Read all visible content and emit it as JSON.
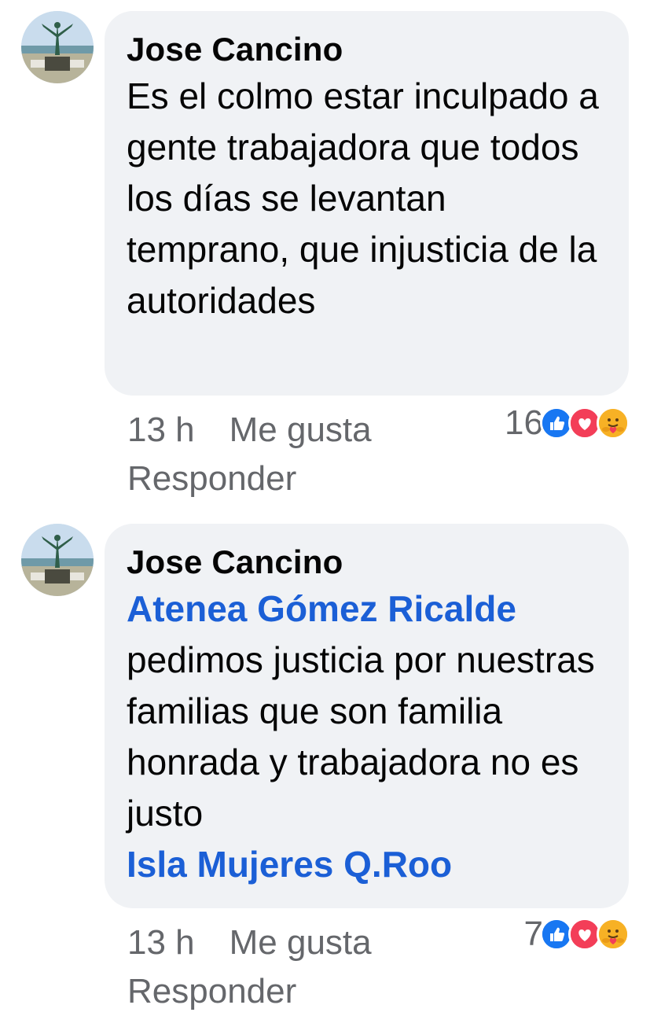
{
  "comments": [
    {
      "author": "Jose Cancino",
      "mention": "",
      "text": "Es el colmo estar inculpado a gente trabajadora que todos los días se levantan temprano, que injusticia de la autoridades",
      "mention_end": "",
      "time": "13 h",
      "like_label": "Me gusta",
      "reply_label": "Responder",
      "reaction_count": "16",
      "reactions": [
        "like-icon",
        "love-icon",
        "care-icon"
      ]
    },
    {
      "author": "Jose Cancino",
      "mention": "Atenea Gómez Ricalde",
      "text": "pedimos justicia por nuestras familias que son familia honrada y trabajadora no es justo",
      "mention_end": "Isla Mujeres Q.Roo",
      "time": "13 h",
      "like_label": "Me gusta",
      "reply_label": "Responder",
      "reaction_count": "7",
      "reactions": [
        "like-icon",
        "love-icon",
        "care-icon"
      ]
    }
  ],
  "colors": {
    "bubble": "#f0f2f5",
    "mention": "#1b5fd6",
    "meta": "#65676b",
    "like": "#1877f2",
    "love": "#f33e58",
    "care": "#f7b125"
  }
}
